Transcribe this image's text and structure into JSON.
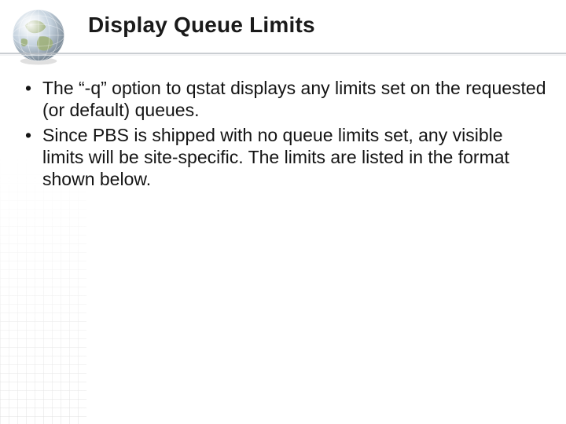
{
  "title": "Display Queue Limits",
  "bullets": [
    "The “-q” option to qstat displays any limits set on the requested (or default) queues.",
    "Since PBS is shipped with no queue limits set, any visible limits will be site-specific. The limits are listed in the format shown below."
  ],
  "icons": {
    "globe": "globe-icon"
  },
  "colors": {
    "text": "#141414",
    "divider_dark": "#9aa0a6",
    "divider_light": "#e6e7e8"
  }
}
